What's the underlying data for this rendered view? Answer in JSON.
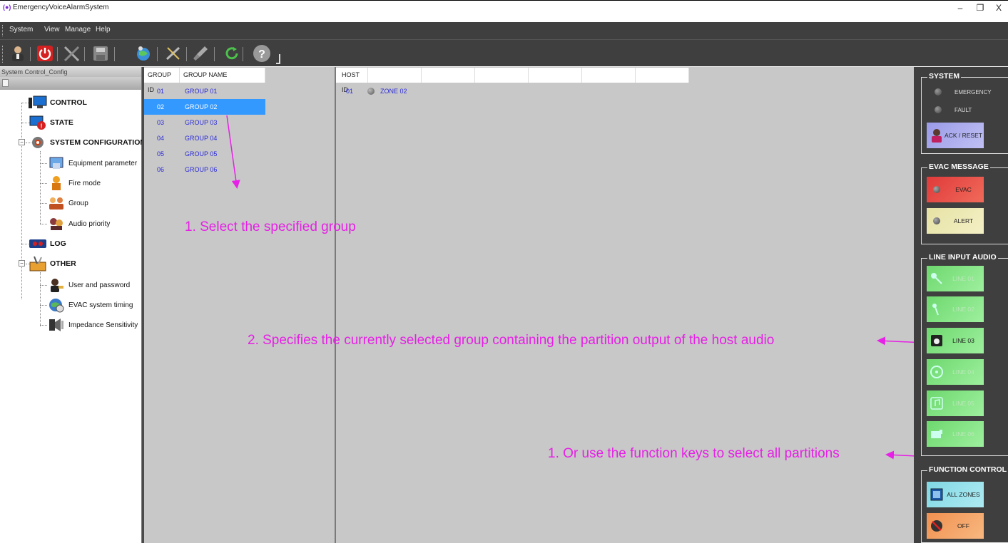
{
  "window": {
    "title": "EmergencyVoiceAlarmSystem",
    "app_icon": "(●)",
    "controls": [
      "–",
      "❐",
      "X"
    ]
  },
  "menu": [
    "System",
    "View",
    "Manage",
    "Help"
  ],
  "toolbar": {
    "icons": [
      "user-icon",
      "power-icon",
      "tools-icon",
      "save-icon",
      "network-icon",
      "wrench-cross-icon",
      "broom-icon",
      "refresh-icon",
      "help-icon"
    ]
  },
  "tree": {
    "header": "System Control_Config",
    "items": [
      {
        "label": "CONTROL",
        "icon": "monitor-icon",
        "bold": true
      },
      {
        "label": "STATE",
        "icon": "state-alert-icon",
        "bold": true
      },
      {
        "label": "SYSTEM CONFIGURATION",
        "icon": "gear-cluster-icon",
        "bold": true
      },
      {
        "label": "Equipment parameter",
        "icon": "equipment-icon",
        "bold": false
      },
      {
        "label": "Fire mode",
        "icon": "fireman-icon",
        "bold": false
      },
      {
        "label": "Group",
        "icon": "group-users-icon",
        "bold": false
      },
      {
        "label": "Audio priority",
        "icon": "audio-priority-icon",
        "bold": false
      },
      {
        "label": "LOG",
        "icon": "log-icon",
        "bold": true
      },
      {
        "label": "OTHER",
        "icon": "toolbox-icon",
        "bold": true
      },
      {
        "label": "User and password",
        "icon": "user-key-icon",
        "bold": false
      },
      {
        "label": "EVAC system timing",
        "icon": "globe-clock-icon",
        "bold": false
      },
      {
        "label": "Impedance Sensitivity",
        "icon": "speaker-icon",
        "bold": false
      }
    ]
  },
  "groups": {
    "columns": [
      "GROUP ID",
      "GROUP NAME"
    ],
    "rows": [
      {
        "id": "01",
        "name": "GROUP 01"
      },
      {
        "id": "02",
        "name": "GROUP 02"
      },
      {
        "id": "03",
        "name": "GROUP 03"
      },
      {
        "id": "04",
        "name": "GROUP 04"
      },
      {
        "id": "05",
        "name": "GROUP 05"
      },
      {
        "id": "06",
        "name": "GROUP 06"
      }
    ],
    "selected": "02"
  },
  "hosts": {
    "columns": [
      "HOST ID",
      "",
      "",
      "",
      "",
      "",
      ""
    ],
    "rows": [
      {
        "id": "01",
        "zone": "ZONE 02"
      }
    ]
  },
  "annotations": {
    "a1": "1. Select the specified group",
    "a2": "2. Specifies the currently selected group containing the partition output of the host audio",
    "a3": "1.  Or use the function keys to select all partitions"
  },
  "right_panel": {
    "system": {
      "title": "SYSTEM",
      "indicators": [
        "EMERGENCY",
        "FAULT"
      ],
      "ack_reset": "ACK / RESET"
    },
    "evac_message": {
      "title": "EVAC MESSAGE",
      "evac": "EVAC",
      "alert": "ALERT"
    },
    "line_input_audio": {
      "title": "LINE INPUT AUDIO",
      "lines": [
        "LINE 01",
        "LINE 02",
        "LINE 03",
        "LINE 04",
        "LINE 05",
        "LINE 06"
      ],
      "active": "LINE 03"
    },
    "function_control": {
      "title": "FUNCTION CONTROL",
      "all_zones": "ALL ZONES",
      "off": "OFF"
    }
  },
  "colors": {
    "annotation": "#e620e6",
    "selection": "#3399ff",
    "evac": "#e84040",
    "alert": "#ece8b0",
    "line": "#7ee87e",
    "all_zones": "#8fe0ea",
    "off": "#f4a060",
    "ack": "#a8a8ec"
  }
}
